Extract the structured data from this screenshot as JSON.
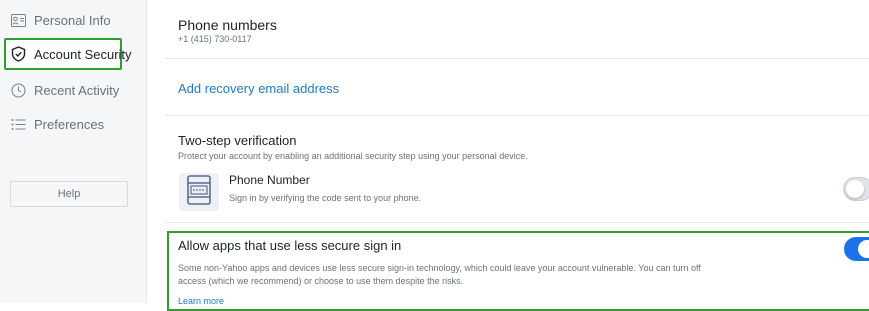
{
  "sidebar": {
    "items": [
      {
        "label": "Personal Info",
        "icon": "id-card-icon"
      },
      {
        "label": "Account Security",
        "icon": "shield-icon"
      },
      {
        "label": "Recent Activity",
        "icon": "clock-icon"
      },
      {
        "label": "Preferences",
        "icon": "list-icon"
      }
    ],
    "help_label": "Help"
  },
  "phone_numbers": {
    "title": "Phone numbers",
    "number": "+1 (415) 730-0117"
  },
  "recovery": {
    "link_label": "Add recovery email address"
  },
  "two_step": {
    "title": "Two-step verification",
    "description": "Protect your account by enabling an additional security step using your personal device.",
    "phone_title": "Phone Number",
    "phone_description": "Sign in by verifying the code sent to your phone.",
    "enabled": false
  },
  "less_secure": {
    "title": "Allow apps that use less secure sign in",
    "description_line1": "Some non-Yahoo apps and devices use less secure sign-in technology, which could leave your account vulnerable. You can turn off",
    "description_line2": "access (which we recommend) or choose to use them despite the risks.",
    "learn_more": "Learn more",
    "enabled": true
  },
  "colors": {
    "accent": "#1e7bc8",
    "toggle_on": "#1a73e8",
    "highlight": "#2e9e2e"
  }
}
